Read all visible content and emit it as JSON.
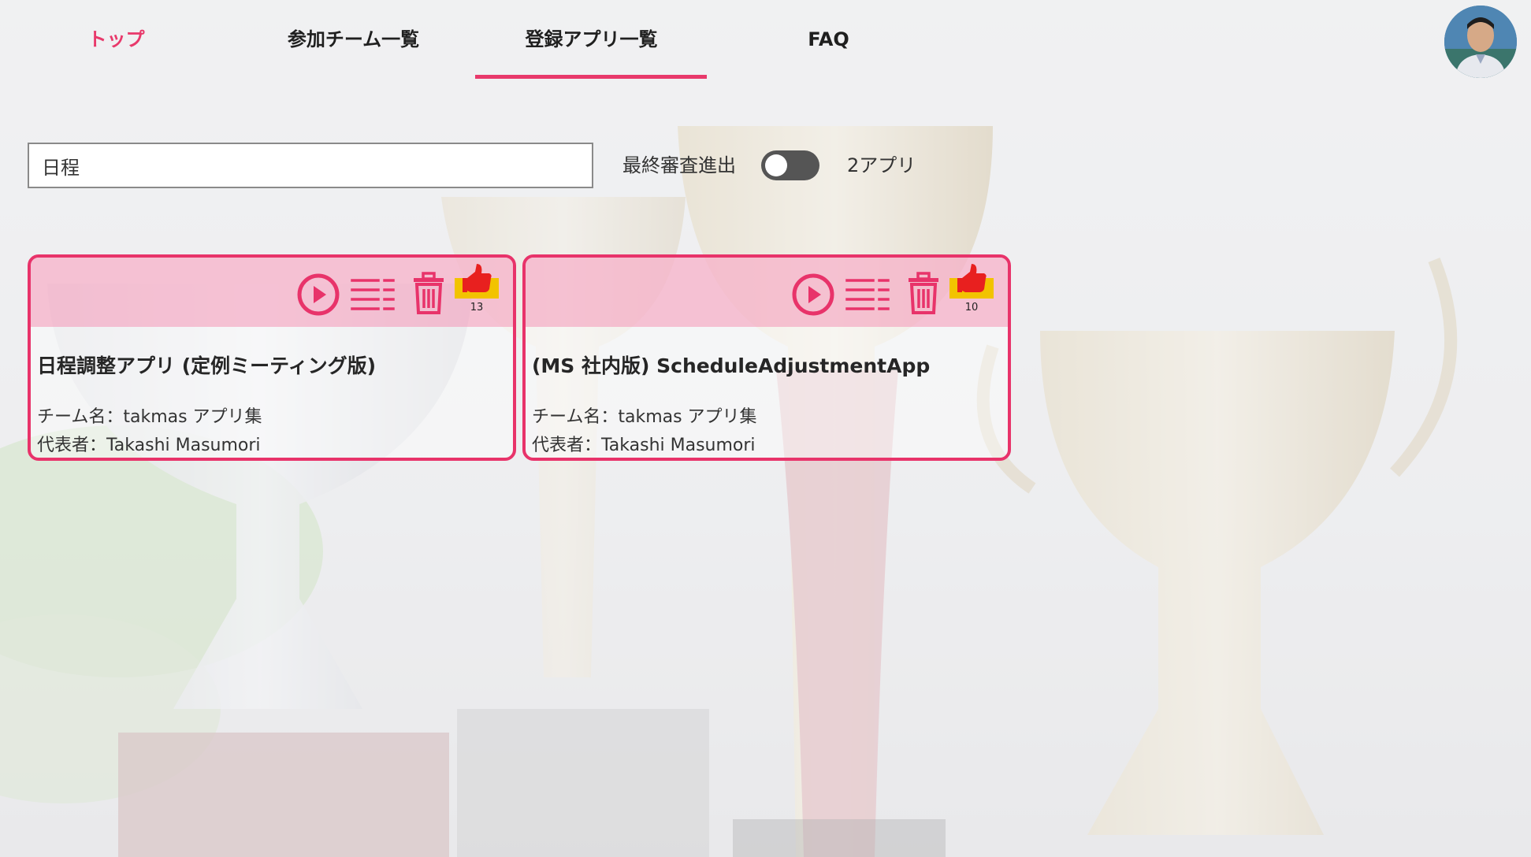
{
  "nav": {
    "tabs": [
      {
        "label": "トップ"
      },
      {
        "label": "参加チーム一覧"
      },
      {
        "label": "登録アプリ一覧"
      },
      {
        "label": "FAQ"
      }
    ],
    "active_tab": "登録アプリ一覧",
    "accent_color": "#e8396b"
  },
  "filter": {
    "search_value": "日程",
    "toggle_label": "最終審査進出",
    "toggle_on": false,
    "count_label": "2アプリ"
  },
  "cards": [
    {
      "title": "日程調整アプリ (定例ミーティング版)",
      "team": "チーム名：takmas アプリ集",
      "owner": "代表者：Takashi Masumori",
      "likes": "13",
      "icons": [
        "play-icon",
        "list-icon",
        "trash-icon",
        "thumbs-up-icon"
      ]
    },
    {
      "title": "(MS 社内版) ScheduleAdjustmentApp",
      "team": "チーム名：takmas アプリ集",
      "owner": "代表者：Takashi Masumori",
      "likes": "10",
      "icons": [
        "play-icon",
        "list-icon",
        "trash-icon",
        "thumbs-up-icon"
      ]
    }
  ],
  "colors": {
    "card_border": "#e8336a",
    "card_header": "#f496b6",
    "like_badge": "#f2c300"
  }
}
